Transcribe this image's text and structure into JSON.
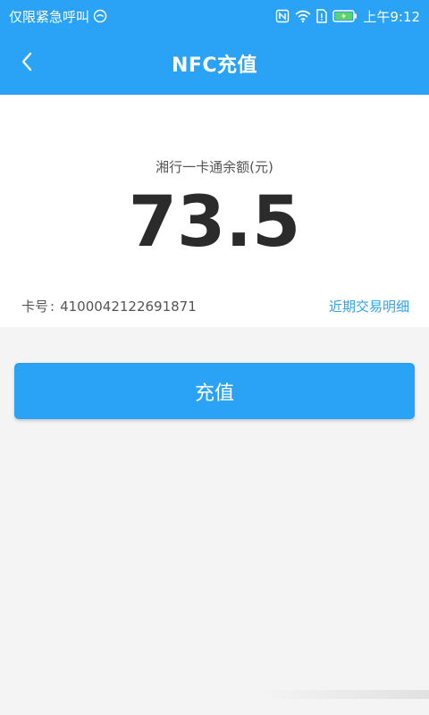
{
  "status_bar": {
    "carrier": "仅限紧急呼叫",
    "time": "上午9:12"
  },
  "app_bar": {
    "title": "NFC充值"
  },
  "balance": {
    "label": "湘行一卡通余额(元)",
    "value": "73.5"
  },
  "card": {
    "number_label": "卡号",
    "separator": ":",
    "number": "4100042122691871",
    "recent_link": "近期交易明细"
  },
  "actions": {
    "recharge_label": "充值"
  },
  "colors": {
    "primary": "#2aa3f7",
    "background": "#f4f4f4",
    "text_dark": "#2b2b2b",
    "text_muted": "#555555"
  },
  "icons": [
    "back-arrow-icon",
    "emergency-icon",
    "nfc-icon",
    "wifi-icon",
    "sim-icon",
    "battery-charging-icon"
  ]
}
